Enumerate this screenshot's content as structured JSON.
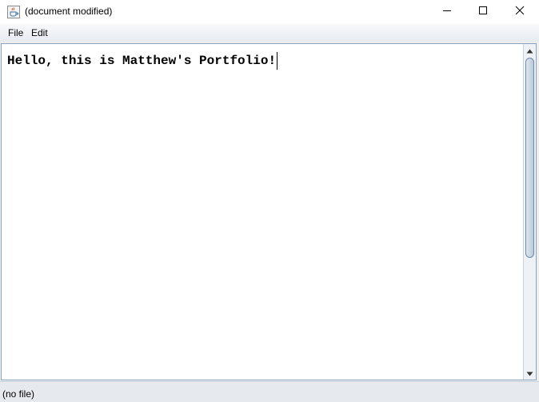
{
  "window": {
    "title": "(document modified)",
    "icons": {
      "app": "java-cup-icon",
      "minimize": "minimize-icon",
      "maximize": "maximize-icon",
      "close": "close-icon"
    }
  },
  "menubar": {
    "items": [
      {
        "label": "File"
      },
      {
        "label": "Edit"
      }
    ]
  },
  "editor": {
    "content": "Hello, this is Matthew's Portfolio!"
  },
  "statusbar": {
    "text": "(no file)"
  },
  "colors": {
    "editor_border": "#8aa4bf",
    "menubar_top": "#f8f9fb",
    "menubar_bottom": "#e6ebf2",
    "statusbar_bg": "#e6e9ee"
  }
}
